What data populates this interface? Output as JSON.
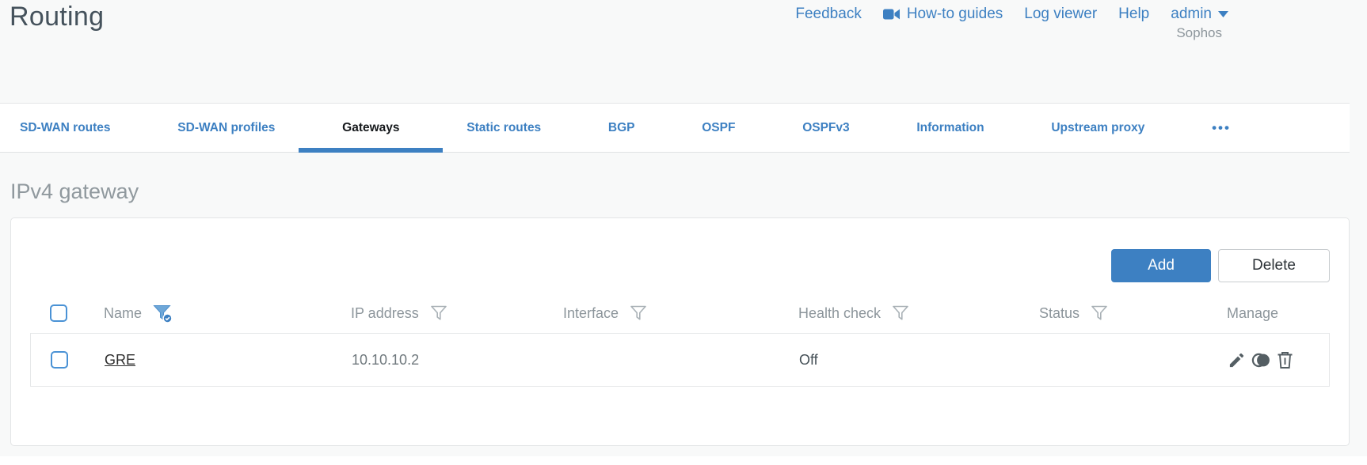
{
  "page_title": "Routing",
  "top_nav": {
    "feedback": "Feedback",
    "howto_guides": "How-to guides",
    "log_viewer": "Log viewer",
    "help": "Help",
    "user_menu": "admin",
    "brand": "Sophos"
  },
  "tabs": {
    "items": [
      {
        "label": "SD-WAN routes",
        "active": false
      },
      {
        "label": "SD-WAN profiles",
        "active": false
      },
      {
        "label": "Gateways",
        "active": true
      },
      {
        "label": "Static routes",
        "active": false
      },
      {
        "label": "BGP",
        "active": false
      },
      {
        "label": "OSPF",
        "active": false
      },
      {
        "label": "OSPFv3",
        "active": false
      },
      {
        "label": "Information",
        "active": false
      },
      {
        "label": "Upstream proxy",
        "active": false
      }
    ],
    "more_icon": "•••"
  },
  "section_heading": "IPv4 gateway",
  "toolbar": {
    "add_label": "Add",
    "delete_label": "Delete"
  },
  "table": {
    "columns": {
      "name": "Name",
      "ip": "IP address",
      "interface": "Interface",
      "health_check": "Health check",
      "status": "Status",
      "manage": "Manage"
    },
    "filters": {
      "name_filter": "active",
      "ip_filter": "inactive",
      "interface_filter": "inactive",
      "health_check_filter": "inactive",
      "status_filter": "inactive"
    },
    "rows": [
      {
        "name": "GRE",
        "ip": "10.10.10.2",
        "interface": "",
        "health_check": "Off",
        "status": "green"
      }
    ]
  },
  "icons": {
    "howto": "videocam-icon",
    "user_caret": "caret-down-icon",
    "manage": [
      "edit-pencil-icon",
      "clone-icon",
      "trash-icon"
    ]
  },
  "colors": {
    "accent_blue": "#3d80c2",
    "status_green": "#8bc63f",
    "heading_gray": "#90999e",
    "add_button_bg": "#3d80c2"
  }
}
